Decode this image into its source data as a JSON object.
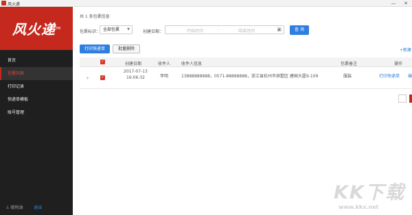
{
  "window": {
    "title": "风火递",
    "minimize": "—",
    "close": "✕"
  },
  "logo": {
    "text": "风火递",
    "tm": "TM"
  },
  "sidebar": {
    "items": [
      {
        "label": "首页"
      },
      {
        "label": "包裹列表",
        "active": true
      },
      {
        "label": "打印记录"
      },
      {
        "label": "快递单模板"
      },
      {
        "label": "账号管理"
      }
    ],
    "user_name": "晓利油",
    "logout": "退出"
  },
  "main": {
    "summary": "共 1 条包裹信息",
    "filter": {
      "tag_label": "包裹标识：",
      "tag_value": "全部包裹",
      "date_label": "创建日期：",
      "start_placeholder": "开始时间",
      "separator": "-",
      "end_placeholder": "结束时间",
      "query": "查 询"
    },
    "toolbar": {
      "print": "打印快递单",
      "delete": "批量删除",
      "new": "+新建"
    },
    "table": {
      "headers": [
        "创建日期",
        "收件人",
        "收件人信息",
        "包裹备注",
        "操作"
      ],
      "rows": [
        {
          "date": "2017-07-13",
          "time": "16:06:32",
          "recipient": "李明",
          "info": "13888888888，0571-88888888，浙江省杭州市拱墅区 建国大厦9-109",
          "note": "服装",
          "action_print": "打印快递单",
          "action_edit": "编"
        }
      ]
    }
  },
  "watermark": {
    "text": "KK下载",
    "url": "www.kkx.net"
  },
  "colors": {
    "brand_red": "#c5281c",
    "link_blue": "#2f7fe0",
    "sidebar_bg": "#1f1f1f"
  }
}
